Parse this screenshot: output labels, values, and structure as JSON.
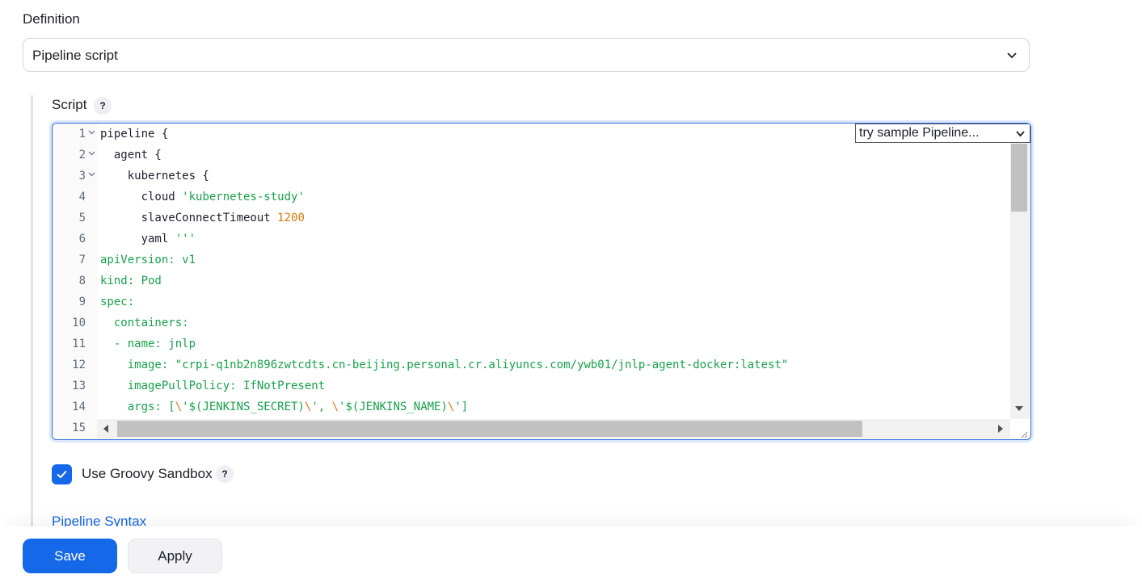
{
  "definition": {
    "label": "Definition",
    "selected": "Pipeline script"
  },
  "script": {
    "label": "Script",
    "help": "?",
    "sample_select": "try sample Pipeline...",
    "lines": [
      {
        "num": "1",
        "fold": true
      },
      {
        "num": "2",
        "fold": true
      },
      {
        "num": "3",
        "fold": true
      },
      {
        "num": "4",
        "fold": false
      },
      {
        "num": "5",
        "fold": false
      },
      {
        "num": "6",
        "fold": false
      },
      {
        "num": "7",
        "fold": false
      },
      {
        "num": "8",
        "fold": false
      },
      {
        "num": "9",
        "fold": false
      },
      {
        "num": "10",
        "fold": false
      },
      {
        "num": "11",
        "fold": false
      },
      {
        "num": "12",
        "fold": false
      },
      {
        "num": "13",
        "fold": false
      },
      {
        "num": "14",
        "fold": false
      },
      {
        "num": "15",
        "fold": false
      }
    ],
    "code": {
      "l1": "pipeline {",
      "l2": "  agent {",
      "l3": "    kubernetes {",
      "l4_kw": "      cloud ",
      "l4_str": "'kubernetes-study'",
      "l5_kw": "      slaveConnectTimeout ",
      "l5_num": "1200",
      "l6_kw": "      yaml ",
      "l6_str": "'''",
      "l7": "apiVersion: v1",
      "l8": "kind: Pod",
      "l9": "spec:",
      "l10": "  containers:",
      "l11": "  - name: jnlp",
      "l12": "    image: \"crpi-q1nb2n896zwtcdts.cn-beijing.personal.cr.aliyuncs.com/ywb01/jnlp-agent-docker:latest\"",
      "l13": "    imagePullPolicy: IfNotPresent",
      "l14_a": "    args: [",
      "l14_b": "\\",
      "l14_c": "'$(JENKINS_SECRET)",
      "l14_d": "\\",
      "l14_e": "', ",
      "l14_f": "\\",
      "l14_g": "'$(JENKINS_NAME)",
      "l14_h": "\\",
      "l14_i": "']",
      "l15": ""
    }
  },
  "sandbox": {
    "label": "Use Groovy Sandbox",
    "checked": true,
    "help": "?"
  },
  "links": {
    "pipeline_syntax": "Pipeline Syntax"
  },
  "buttons": {
    "save": "Save",
    "apply": "Apply"
  },
  "colors": {
    "accent": "#1568e8",
    "string": "#16a34a",
    "number": "#d97706"
  }
}
